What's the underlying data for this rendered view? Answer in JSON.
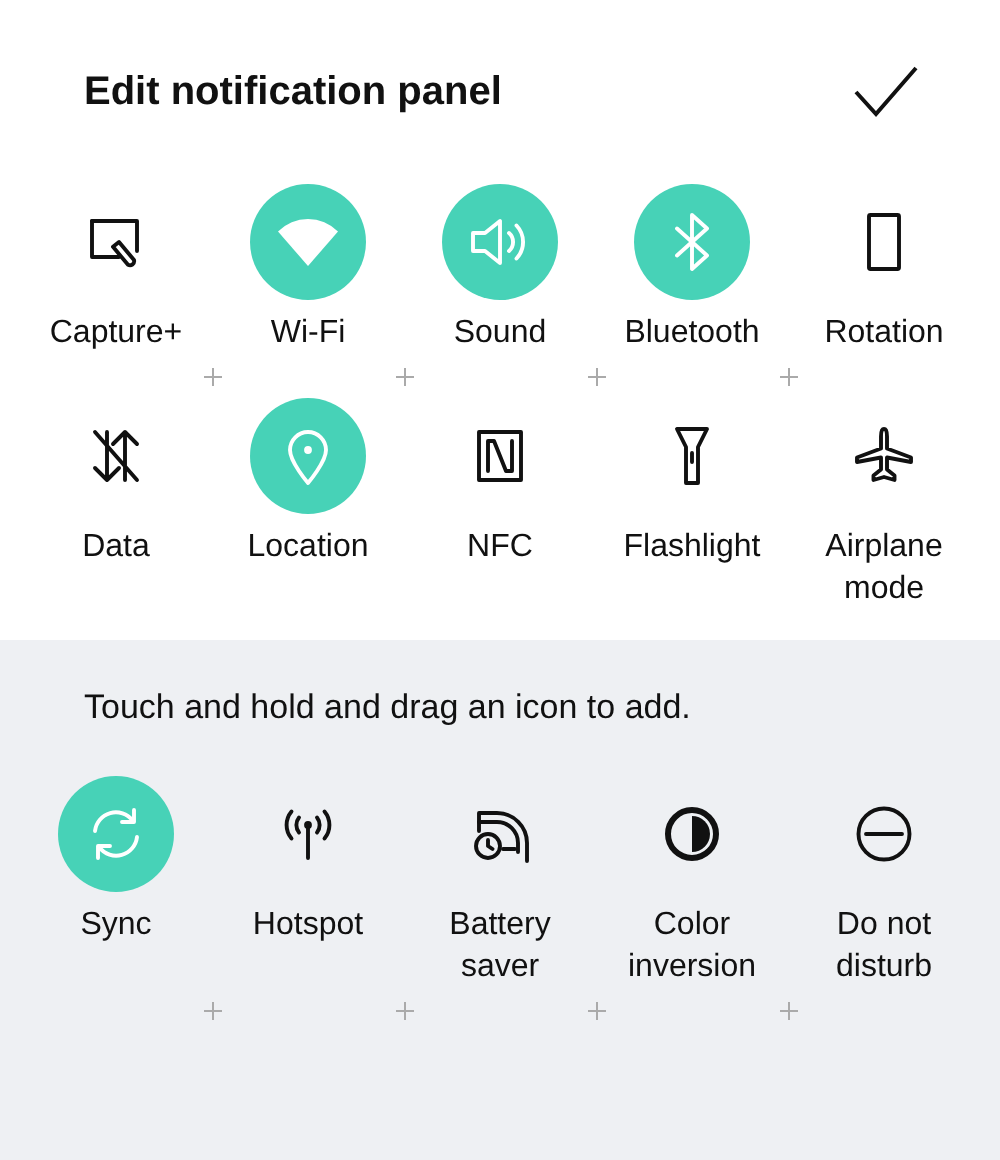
{
  "header": {
    "title": "Edit notification panel"
  },
  "active_tiles": [
    {
      "kind": "capture",
      "label": "Capture+",
      "on": false
    },
    {
      "kind": "wifi",
      "label": "Wi-Fi",
      "on": true
    },
    {
      "kind": "sound",
      "label": "Sound",
      "on": true
    },
    {
      "kind": "bluetooth",
      "label": "Bluetooth",
      "on": true
    },
    {
      "kind": "rotation",
      "label": "Rotation",
      "on": false
    },
    {
      "kind": "data",
      "label": "Data",
      "on": false
    },
    {
      "kind": "location",
      "label": "Location",
      "on": true
    },
    {
      "kind": "nfc",
      "label": "NFC",
      "on": false
    },
    {
      "kind": "flashlight",
      "label": "Flashlight",
      "on": false
    },
    {
      "kind": "airplane",
      "label": "Airplane mode",
      "on": false
    }
  ],
  "hint": "Touch and hold and drag an icon to add.",
  "available_tiles": [
    {
      "kind": "sync",
      "label": "Sync",
      "on": true
    },
    {
      "kind": "hotspot",
      "label": "Hotspot",
      "on": false
    },
    {
      "kind": "battery",
      "label": "Battery saver",
      "on": false
    },
    {
      "kind": "inversion",
      "label": "Color inversion",
      "on": false
    },
    {
      "kind": "dnd",
      "label": "Do not disturb",
      "on": false
    }
  ]
}
